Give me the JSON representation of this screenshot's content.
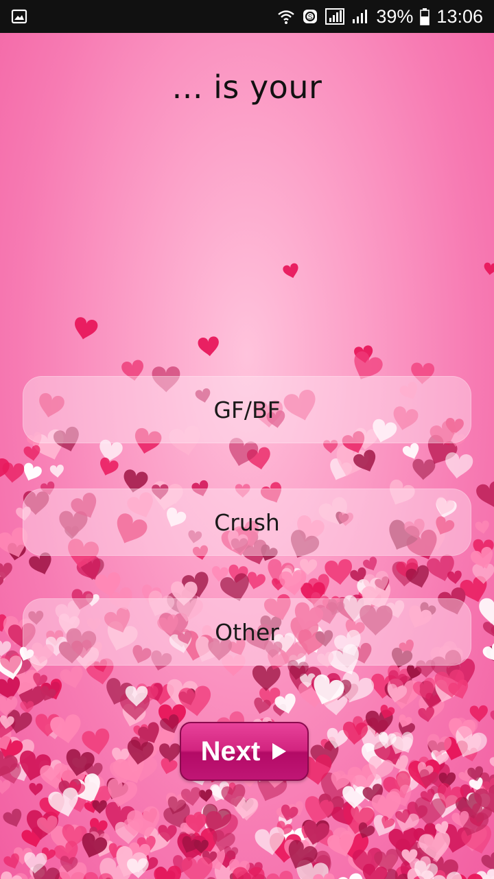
{
  "status_bar": {
    "battery": "39%",
    "time": "13:06",
    "icons": [
      "gallery-notification-icon",
      "wifi-icon",
      "data-saver-icon",
      "signal-icon",
      "signal-icon",
      "battery-icon"
    ]
  },
  "title": "... is your",
  "options": [
    {
      "label": "GF/BF"
    },
    {
      "label": "Crush"
    },
    {
      "label": "Other"
    }
  ],
  "next_button": {
    "label": "Next",
    "icon": "play-arrow-icon"
  },
  "colors": {
    "background": "#f77bb3",
    "heart_palette": [
      "#e8185c",
      "#f03b7a",
      "#d11458",
      "#9d1343",
      "#ff88b5",
      "#ffb6d1",
      "#ffffff",
      "#c2275f"
    ]
  }
}
